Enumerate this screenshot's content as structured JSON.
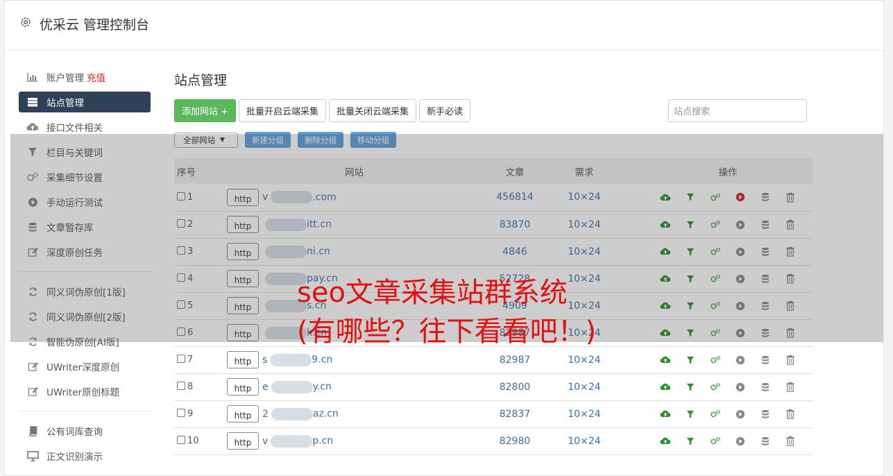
{
  "header": {
    "title": "优采云 管理控制台"
  },
  "sidebar": {
    "items": [
      {
        "label": "账户管理",
        "extra": "充值",
        "icon": "bar-chart-icon"
      },
      {
        "label": "站点管理",
        "icon": "server-icon",
        "active": true
      },
      {
        "label": "接口文件相关",
        "icon": "cloud-upload-icon"
      },
      {
        "label": "栏目与关键词",
        "icon": "filter-icon"
      },
      {
        "label": "采集细节设置",
        "icon": "gears-icon"
      },
      {
        "label": "手动运行测试",
        "icon": "play-icon"
      },
      {
        "label": "文章暂存库",
        "icon": "database-icon"
      },
      {
        "label": "深度原创任务",
        "icon": "edit-icon"
      },
      {
        "label": "同义词伪原创[1版]",
        "icon": "refresh-icon"
      },
      {
        "label": "同义词伪原创[2版]",
        "icon": "refresh-icon"
      },
      {
        "label": "智能伪原创[AI版]",
        "icon": "refresh-icon"
      },
      {
        "label": "UWriter深度原创",
        "icon": "edit-icon"
      },
      {
        "label": "UWriter原创标题",
        "icon": "edit-icon"
      },
      {
        "label": "公有词库查询",
        "icon": "book-icon"
      },
      {
        "label": "正文识别演示",
        "icon": "monitor-icon"
      }
    ]
  },
  "main": {
    "title": "站点管理",
    "buttons": {
      "add": "添加网站 +",
      "batch_on": "批量开启云端采集",
      "batch_off": "批量关闭云端采集",
      "guide": "新手必读"
    },
    "search_placeholder": "站点搜索",
    "group_select": "全部网站",
    "group_buttons": {
      "new": "新建分组",
      "delete": "删除分组",
      "move": "移动分组"
    },
    "table": {
      "headers": {
        "no": "序号",
        "site": "网站",
        "articles": "文章",
        "demand": "需求",
        "ops": "操作"
      },
      "http_label": "http",
      "rows": [
        {
          "no": "1",
          "prefix": "v",
          "suffix": ".com",
          "articles": "456814",
          "demand": "10×24",
          "play_red": true
        },
        {
          "no": "2",
          "prefix": "",
          "suffix": "itt.cn",
          "articles": "83870",
          "demand": "10×24",
          "play_red": false
        },
        {
          "no": "3",
          "prefix": "",
          "suffix": "ni.cn",
          "articles": "4846",
          "demand": "10×24",
          "play_red": false
        },
        {
          "no": "4",
          "prefix": "",
          "suffix": "pay.cn",
          "articles": "52728",
          "demand": "10×24",
          "play_red": false
        },
        {
          "no": "5",
          "prefix": "",
          "suffix": "s.cn",
          "articles": "4909",
          "demand": "10×24",
          "play_red": false
        },
        {
          "no": "6",
          "prefix": "",
          "suffix": "k.cn",
          "articles": "82987",
          "demand": "10×24",
          "play_red": false
        },
        {
          "no": "7",
          "prefix": "s",
          "suffix": "9.cn",
          "articles": "82987",
          "demand": "10×24",
          "play_red": false
        },
        {
          "no": "8",
          "prefix": "e",
          "suffix": "y.cn",
          "articles": "82800",
          "demand": "10×24",
          "play_red": false
        },
        {
          "no": "9",
          "prefix": "2",
          "suffix": "az.cn",
          "articles": "82837",
          "demand": "10×24",
          "play_red": false
        },
        {
          "no": "10",
          "prefix": "v",
          "suffix": "p.cn",
          "articles": "82980",
          "demand": "10×24",
          "play_red": false
        }
      ]
    }
  },
  "overlay": {
    "headline": "seo文章采集站群系统(有哪些？往下看看吧！)"
  },
  "colors": {
    "accent": "#2f4059",
    "green": "#5cb85c",
    "link": "#3a6fa8",
    "headline": "#e31010"
  }
}
